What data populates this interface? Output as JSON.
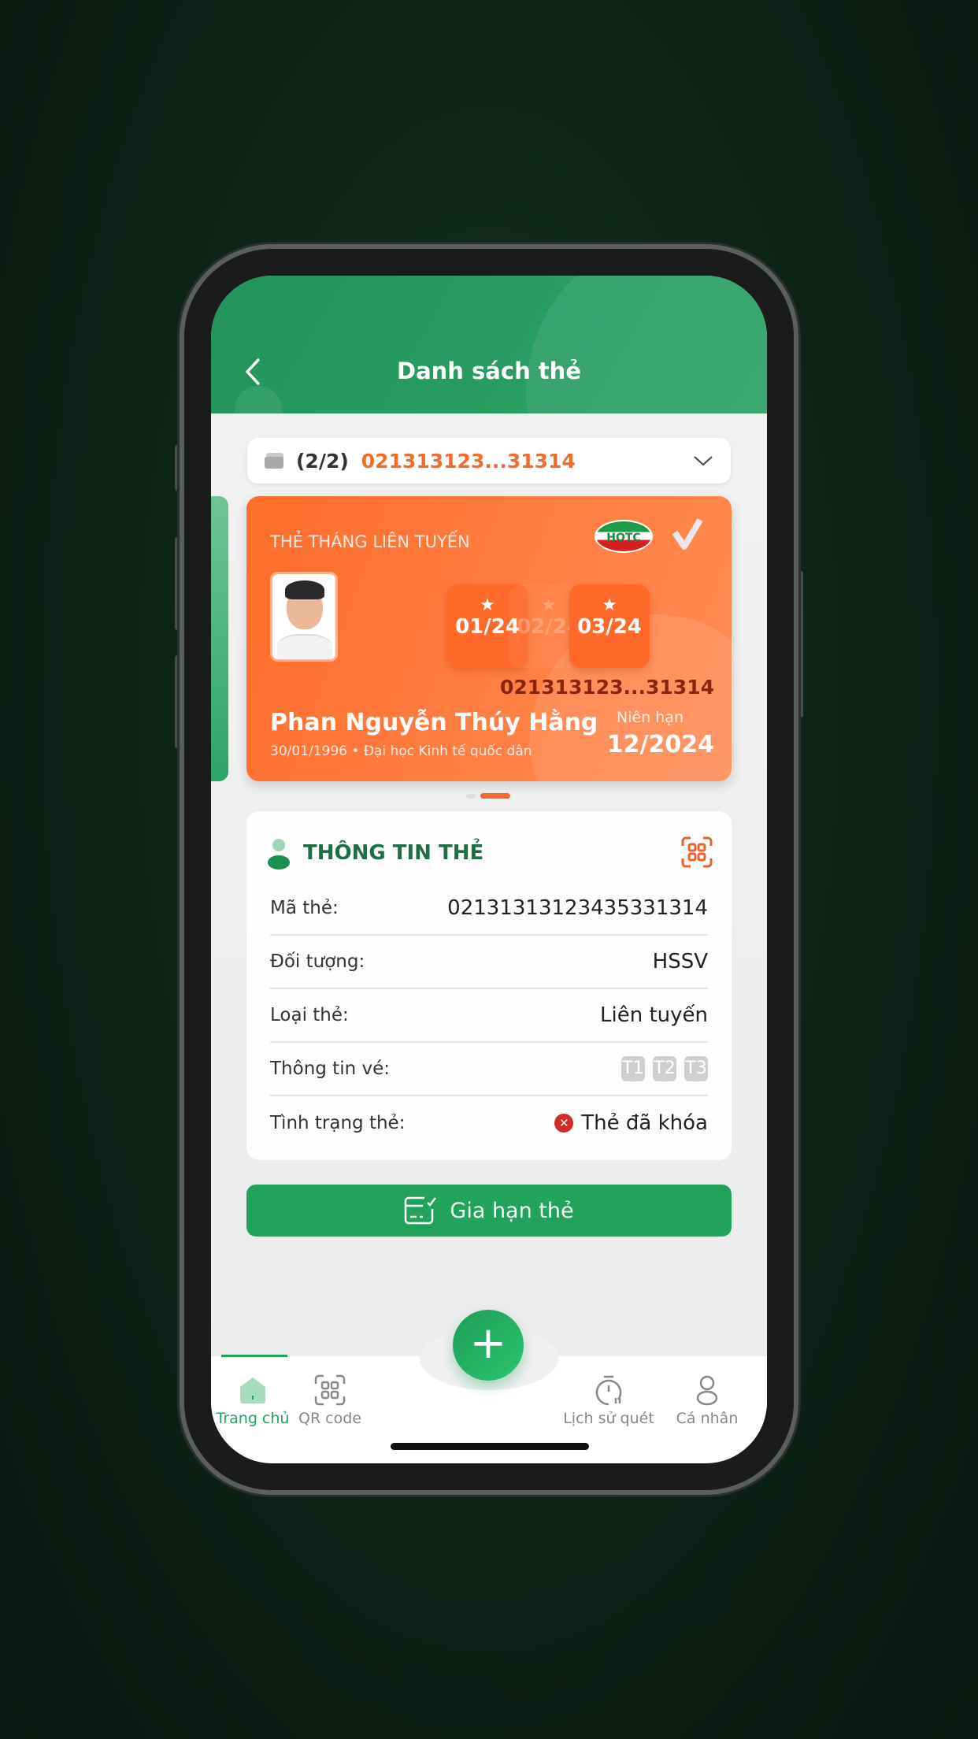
{
  "header": {
    "title": "Danh sách thẻ",
    "back_icon": "chevron-left-icon"
  },
  "selector": {
    "count": "(2/2)",
    "card_number": "021313123...31314",
    "icon": "card-icon",
    "chevron": "chevron-down-icon"
  },
  "card": {
    "type_label": "THẺ THÁNG LIÊN TUYẾN",
    "logo_text": "HOTC",
    "months": [
      {
        "label": "01/24",
        "active": true
      },
      {
        "label": "02/24",
        "active": false
      },
      {
        "label": "03/24",
        "active": true
      }
    ],
    "card_number": "021313123...31314",
    "name": "Phan Nguyễn Thúy Hằng",
    "dob": "30/01/1996",
    "school": "Đại học Kinh tế quốc dân",
    "expiry_label": "Niên hạn",
    "expiry": "12/2024"
  },
  "info": {
    "title": "THÔNG TIN THẺ",
    "rows": [
      {
        "label": "Mã thẻ:",
        "value": "021313131234353313 14"
      },
      {
        "label": "Đối tượng:",
        "value": "HSSV"
      },
      {
        "label": "Loại thẻ:",
        "value": "Liên tuyến"
      },
      {
        "label": "Thông tin vé:",
        "tags": [
          "T1",
          "T2",
          "T3"
        ]
      },
      {
        "label": "Tình trạng thẻ:",
        "value": "Thẻ đã khóa"
      }
    ],
    "card_code": "02131313123435331314"
  },
  "renew_button": "Gia hạn thẻ",
  "tabs": [
    {
      "label": "Trang chủ",
      "icon": "home-icon",
      "active": true
    },
    {
      "label": "QR code",
      "icon": "qr-icon"
    },
    {
      "label": "Lịch sử quét",
      "icon": "timer-icon"
    },
    {
      "label": "Cá nhân",
      "icon": "person-icon"
    }
  ],
  "colors": {
    "primary": "#22a35c",
    "accent": "#ff6d2b",
    "error": "#d42a2a"
  }
}
